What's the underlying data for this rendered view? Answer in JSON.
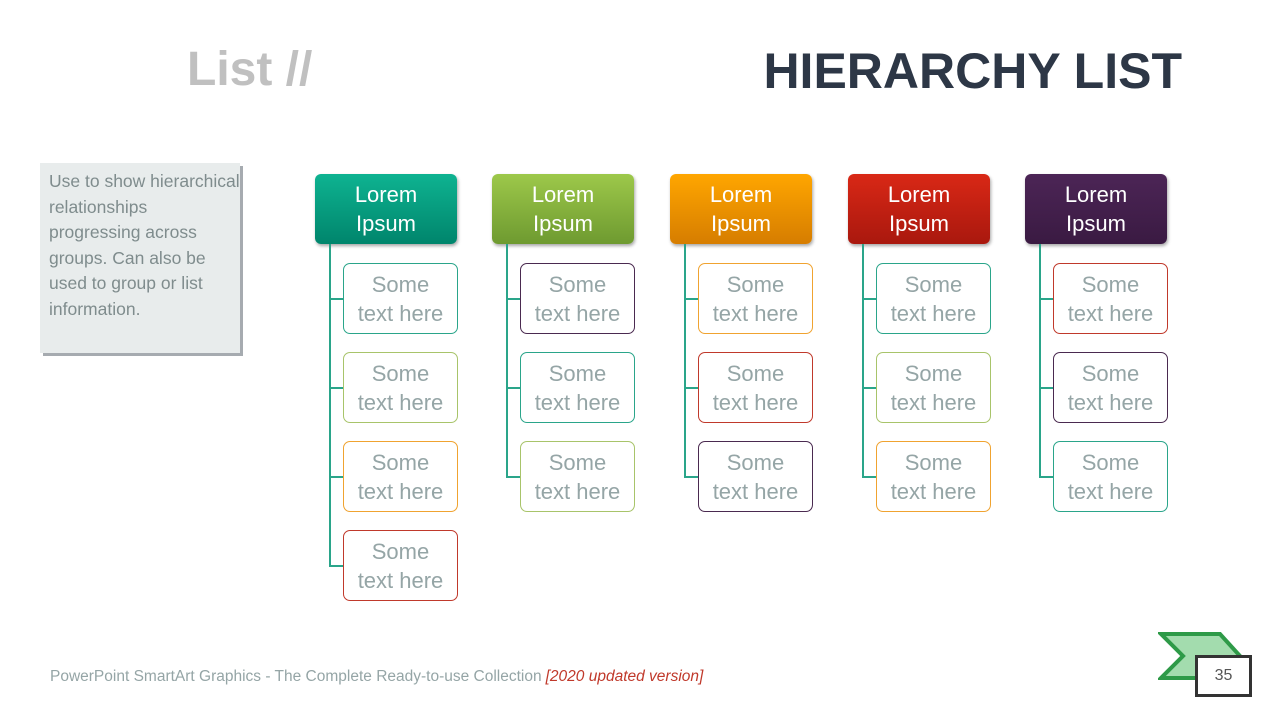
{
  "slide": {
    "section_title": "List //",
    "main_title": "HIERARCHY LIST",
    "description": "Use to show hierarchical relationships progressing across groups. Can also be used to group or list information.",
    "footer_text": "PowerPoint SmartArt Graphics - The Complete Ready-to-use Collection",
    "footer_accent": "[2020 updated version]",
    "page_number": "35"
  },
  "colors": {
    "connector": "#2aa58a",
    "title_dark": "#2d3746",
    "title_light": "#c0c0c0",
    "footer_accent": "#c0392b"
  },
  "columns": [
    {
      "header": "Lorem\nIpsum",
      "header_color_top": "#0eb391",
      "header_color_bottom": "#00856c",
      "items": [
        {
          "text": "Some\ntext here",
          "border": "#2aa58a"
        },
        {
          "text": "Some\ntext here",
          "border": "#a8c46a"
        },
        {
          "text": "Some\ntext here",
          "border": "#f0a330"
        },
        {
          "text": "Some\ntext here",
          "border": "#c0392b"
        }
      ]
    },
    {
      "header": "Lorem\nIpsum",
      "header_color_top": "#9dc84a",
      "header_color_bottom": "#6e9a30",
      "items": [
        {
          "text": "Some\ntext here",
          "border": "#4a2a50"
        },
        {
          "text": "Some\ntext here",
          "border": "#2aa58a"
        },
        {
          "text": "Some\ntext here",
          "border": "#a8c46a"
        }
      ]
    },
    {
      "header": "Lorem\nIpsum",
      "header_color_top": "#ffa600",
      "header_color_bottom": "#d67d00",
      "items": [
        {
          "text": "Some\ntext here",
          "border": "#f0a330"
        },
        {
          "text": "Some\ntext here",
          "border": "#c0392b"
        },
        {
          "text": "Some\ntext here",
          "border": "#4a2a50"
        }
      ]
    },
    {
      "header": "Lorem\nIpsum",
      "header_color_top": "#d92816",
      "header_color_bottom": "#a9180e",
      "items": [
        {
          "text": "Some\ntext here",
          "border": "#2aa58a"
        },
        {
          "text": "Some\ntext here",
          "border": "#a8c46a"
        },
        {
          "text": "Some\ntext here",
          "border": "#f0a330"
        }
      ]
    },
    {
      "header": "Lorem\nIpsum",
      "header_color_top": "#4c2556",
      "header_color_bottom": "#3a1a42",
      "items": [
        {
          "text": "Some\ntext here",
          "border": "#c0392b"
        },
        {
          "text": "Some\ntext here",
          "border": "#4a2a50"
        },
        {
          "text": "Some\ntext here",
          "border": "#2aa58a"
        }
      ]
    }
  ]
}
